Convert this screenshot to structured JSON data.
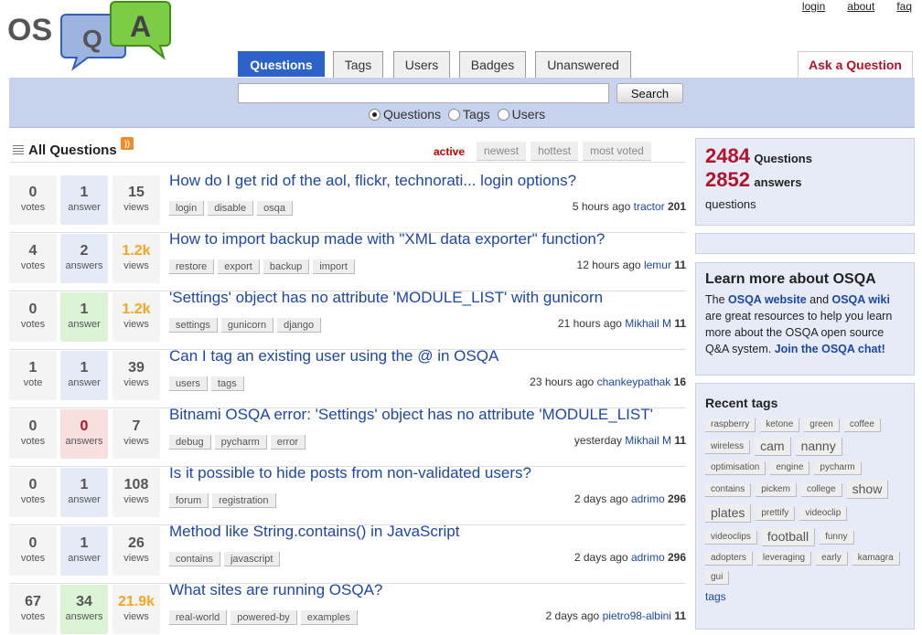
{
  "header": {
    "logo_letters": [
      "OS",
      "Q",
      "A"
    ],
    "top_links": [
      "login",
      "about",
      "faq"
    ]
  },
  "tabs": [
    "Questions",
    "Tags",
    "Users",
    "Badges",
    "Unanswered"
  ],
  "ask_button": "Ask a Question",
  "search": {
    "value": "",
    "button": "Search",
    "options": [
      "Questions",
      "Tags",
      "Users"
    ],
    "selected": "Questions"
  },
  "list": {
    "heading": "All Questions",
    "sort_tabs": [
      "active",
      "newest",
      "hottest",
      "most voted"
    ],
    "active_sort": "active"
  },
  "questions": [
    {
      "votes": "0",
      "votes_label": "votes",
      "answers": "1",
      "answers_label": "answer",
      "views": "15",
      "views_label": "views",
      "title": "How do I get rid of the aol, flickr, technorati... login options?",
      "tags": [
        "login",
        "disable",
        "osqa"
      ],
      "time": "5 hours ago",
      "user": "tractor",
      "rep": "201"
    },
    {
      "votes": "4",
      "votes_label": "votes",
      "answers": "2",
      "answers_label": "answers",
      "views": "1.2k",
      "views_label": "views",
      "title": "How to import backup made with \"XML data exporter\" function?",
      "tags": [
        "restore",
        "export",
        "backup",
        "import"
      ],
      "time": "12 hours ago",
      "user": "lemur",
      "rep": "11"
    },
    {
      "votes": "0",
      "votes_label": "votes",
      "answers": "1",
      "answers_label": "answer",
      "views": "1.2k",
      "views_label": "views",
      "title": "'Settings' object has no attribute 'MODULE_LIST' with gunicorn",
      "tags": [
        "settings",
        "gunicorn",
        "django"
      ],
      "time": "21 hours ago",
      "user": "Mikhail M",
      "rep": "11"
    },
    {
      "votes": "1",
      "votes_label": "vote",
      "answers": "1",
      "answers_label": "answer",
      "views": "39",
      "views_label": "views",
      "title": "Can I tag an existing user using the @ in OSQA",
      "tags": [
        "users",
        "tags"
      ],
      "time": "23 hours ago",
      "user": "chankeypathak",
      "rep": "16"
    },
    {
      "votes": "0",
      "votes_label": "votes",
      "answers": "0",
      "answers_label": "answers",
      "views": "7",
      "views_label": "views",
      "title": "Bitnami OSQA error: 'Settings' object has no attribute 'MODULE_LIST'",
      "tags": [
        "debug",
        "pycharm",
        "error"
      ],
      "time": "yesterday",
      "user": "Mikhail M",
      "rep": "11"
    },
    {
      "votes": "0",
      "votes_label": "votes",
      "answers": "1",
      "answers_label": "answer",
      "views": "108",
      "views_label": "views",
      "title": "Is it possible to hide posts from non-validated users?",
      "tags": [
        "forum",
        "registration"
      ],
      "time": "2 days ago",
      "user": "adrimo",
      "rep": "296"
    },
    {
      "votes": "0",
      "votes_label": "votes",
      "answers": "1",
      "answers_label": "answer",
      "views": "26",
      "views_label": "views",
      "title": "Method like String.contains() in JavaScript",
      "tags": [
        "contains",
        "javascript"
      ],
      "time": "2 days ago",
      "user": "adrimo",
      "rep": "296"
    },
    {
      "votes": "67",
      "votes_label": "votes",
      "answers": "34",
      "answers_label": "answers",
      "views": "21.9k",
      "views_label": "views",
      "title": "What sites are running OSQA?",
      "tags": [
        "real-world",
        "powered-by",
        "examples"
      ],
      "time": "2 days ago",
      "user": "pietro98-albini",
      "rep": "11"
    }
  ],
  "stats": {
    "questions_count": "2484",
    "questions_label": "Questions",
    "answers_count": "2852",
    "answers_label": "answers",
    "footer": "questions"
  },
  "learn": {
    "title": "Learn more about OSQA",
    "t1": "The ",
    "link1": "OSQA website",
    "t2": " and ",
    "link2": "OSQA wiki",
    "t3": " are great resources to help you learn more about the OSQA open source Q&A system. ",
    "link3": "Join the OSQA chat!"
  },
  "recent_tags": {
    "title": "Recent tags",
    "items": [
      {
        "name": "raspberry",
        "large": false
      },
      {
        "name": "ketone",
        "large": false
      },
      {
        "name": "green",
        "large": false
      },
      {
        "name": "coffee",
        "large": false
      },
      {
        "name": "wireless",
        "large": false
      },
      {
        "name": "cam",
        "large": true
      },
      {
        "name": "nanny",
        "large": true
      },
      {
        "name": "optimisation",
        "large": false
      },
      {
        "name": "engine",
        "large": false
      },
      {
        "name": "pycharm",
        "large": false
      },
      {
        "name": "contains",
        "large": false
      },
      {
        "name": "pickem",
        "large": false
      },
      {
        "name": "college",
        "large": false
      },
      {
        "name": "show",
        "large": true
      },
      {
        "name": "plates",
        "large": true
      },
      {
        "name": "prettify",
        "large": false
      },
      {
        "name": "videoclip",
        "large": false
      },
      {
        "name": "videoclips",
        "large": false
      },
      {
        "name": "football",
        "large": true
      },
      {
        "name": "funny",
        "large": false
      },
      {
        "name": "adopters",
        "large": false
      },
      {
        "name": "leveraging",
        "large": false
      },
      {
        "name": "early",
        "large": false
      },
      {
        "name": "kamagra",
        "large": false
      },
      {
        "name": "gui",
        "large": false
      }
    ],
    "more_link": "tags"
  }
}
